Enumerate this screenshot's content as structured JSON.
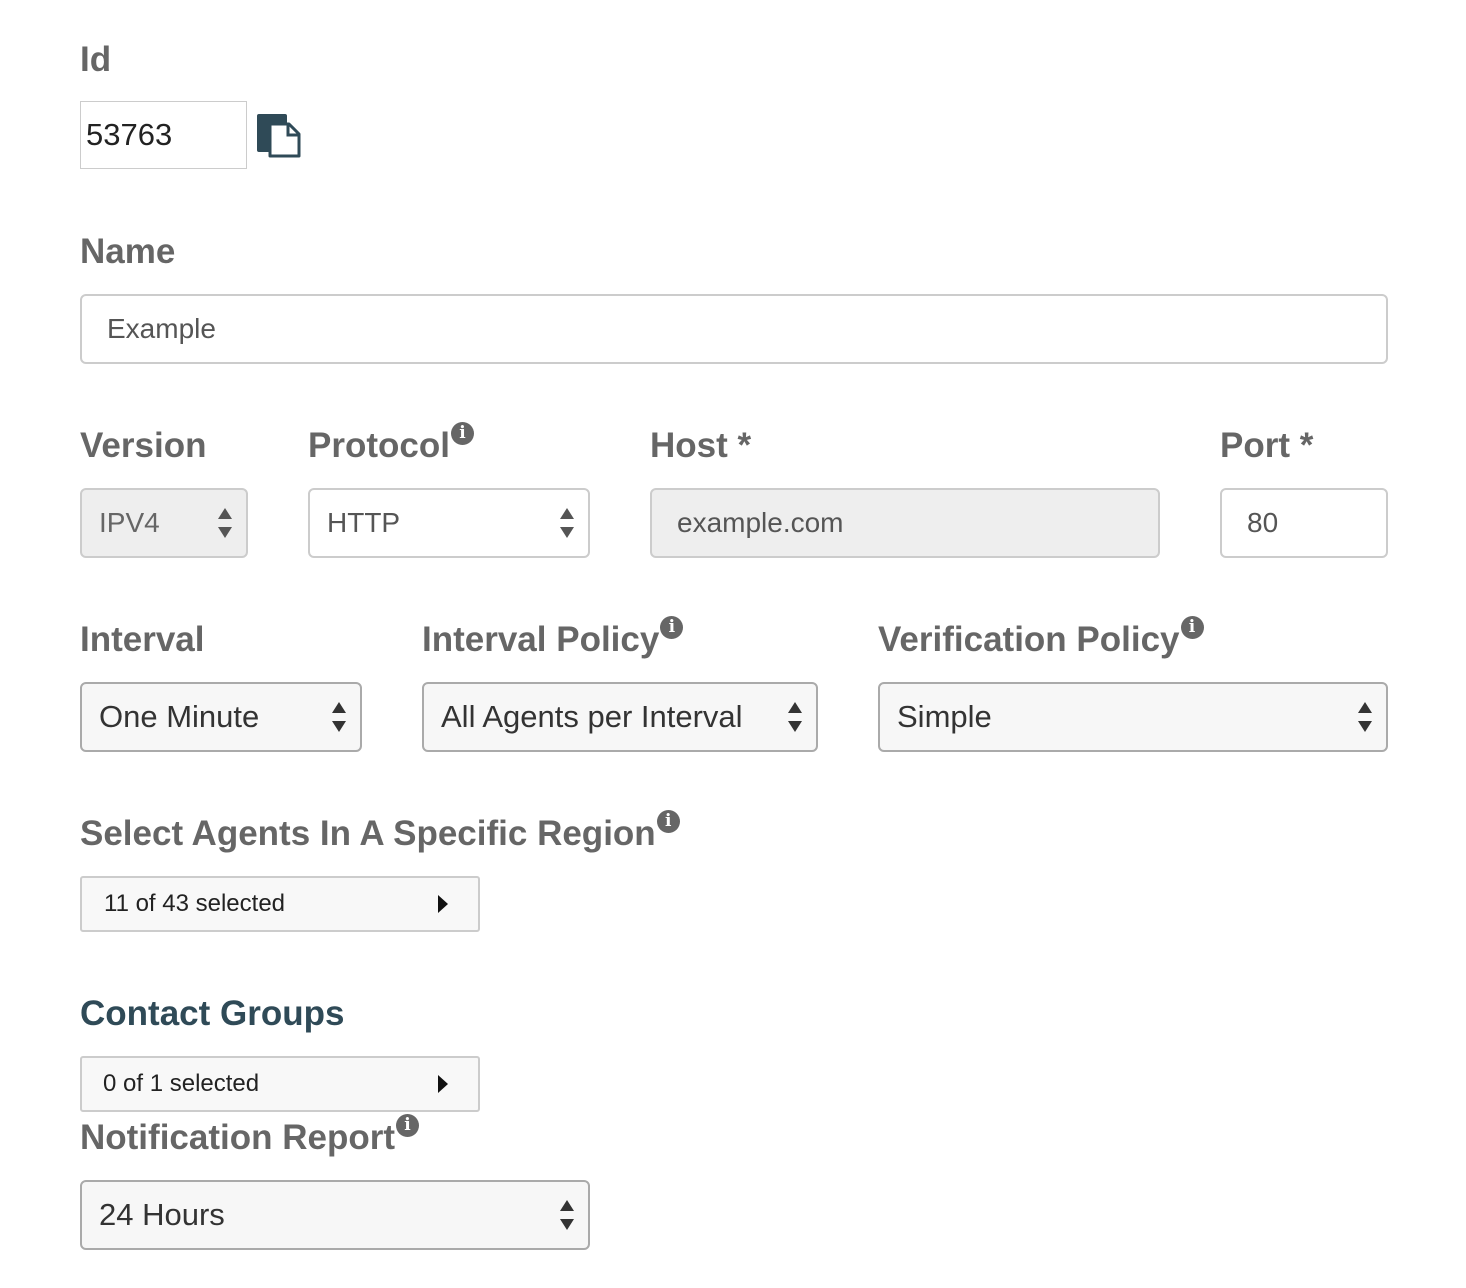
{
  "id_field": {
    "label": "Id",
    "value": "53763"
  },
  "name_field": {
    "label": "Name",
    "value": "Example"
  },
  "version": {
    "label": "Version",
    "value": "IPV4"
  },
  "protocol": {
    "label": "Protocol",
    "value": "HTTP"
  },
  "host": {
    "label": "Host *",
    "value": "example.com"
  },
  "port": {
    "label": "Port *",
    "value": "80"
  },
  "interval": {
    "label": "Interval",
    "value": "One Minute"
  },
  "interval_policy": {
    "label": "Interval Policy",
    "value": "All Agents per Interval"
  },
  "verification_policy": {
    "label": "Verification Policy",
    "value": "Simple"
  },
  "region": {
    "label": "Select Agents In A Specific Region",
    "value": "11 of 43 selected"
  },
  "contact_groups": {
    "label": "Contact Groups",
    "value": "0 of 1 selected"
  },
  "notification_report": {
    "label": "Notification Report",
    "value": "24 Hours"
  },
  "info_glyph": "i",
  "colors": {
    "label": "#666666",
    "section_heading": "#2f4a57",
    "border": "#cccccc",
    "disabled_bg": "#eeeeee"
  },
  "icons": {
    "copy": "copy-icon",
    "info": "info-icon",
    "select_arrows": "up-down-arrows-icon",
    "expand": "caret-right-icon"
  }
}
